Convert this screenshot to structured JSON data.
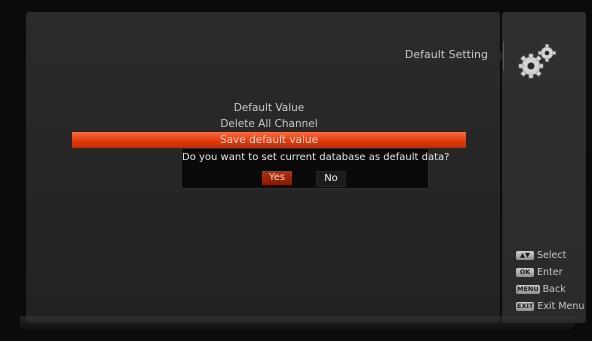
{
  "menu": {
    "title": "Default Setting",
    "items": [
      {
        "label": "Default Value"
      },
      {
        "label": "Delete All Channel"
      },
      {
        "label": "Save default value"
      }
    ],
    "selected_index": 2
  },
  "dialog": {
    "message": "Do you want to set current database as default data?",
    "yes_label": "Yes",
    "no_label": "No",
    "focused": "Yes"
  },
  "help": {
    "items": [
      {
        "key": "▲▼",
        "label": "Select"
      },
      {
        "key": "OK",
        "label": "Enter"
      },
      {
        "key": "MENU",
        "label": "Back"
      },
      {
        "key": "EXIT",
        "label": "Exit Menu"
      }
    ]
  },
  "icons": {
    "settings": "gears-icon"
  },
  "colors": {
    "selected_item": "#e23a10",
    "focused_button": "#a32a0a"
  }
}
